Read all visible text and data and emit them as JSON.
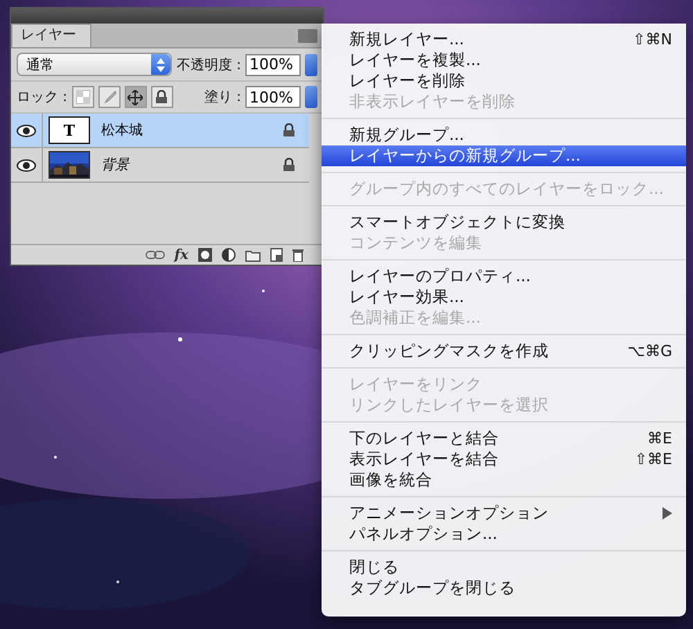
{
  "panel": {
    "tab": "レイヤー",
    "blend_mode": "通常",
    "opacity_label": "不透明度 :",
    "opacity": "100%",
    "lock_label": "ロック :",
    "fill_label": "塗り :",
    "fill": "100%",
    "locks": [
      {
        "kind": "pixels",
        "selected": false
      },
      {
        "kind": "paint",
        "selected": false
      },
      {
        "kind": "position",
        "selected": true
      },
      {
        "kind": "all",
        "selected": false
      }
    ],
    "layers": [
      {
        "kind": "text",
        "thumbnail_text": "T",
        "name": "松本城",
        "visible": true,
        "selected": true,
        "locked": true
      },
      {
        "name": "背景",
        "visible": true,
        "selected": false,
        "locked": true
      }
    ],
    "fx_label": "fx"
  },
  "menu": [
    {
      "items": [
        {
          "label": "新規レイヤー...",
          "shortcut": "⇧⌘N",
          "disabled": false,
          "selected": false
        },
        {
          "label": "レイヤーを複製...",
          "disabled": false,
          "selected": false
        },
        {
          "label": "レイヤーを削除",
          "disabled": false,
          "selected": false
        },
        {
          "label": "非表示レイヤーを削除",
          "disabled": true,
          "selected": false
        }
      ]
    },
    {
      "items": [
        {
          "label": "新規グループ...",
          "disabled": false,
          "selected": false
        },
        {
          "label": "レイヤーからの新規グループ...",
          "disabled": false,
          "selected": true
        }
      ]
    },
    {
      "items": [
        {
          "label": "グループ内のすべてのレイヤーをロック...",
          "disabled": true,
          "selected": false
        }
      ]
    },
    {
      "items": [
        {
          "label": "スマートオブジェクトに変換",
          "disabled": false,
          "selected": false
        },
        {
          "label": "コンテンツを編集",
          "disabled": true,
          "selected": false
        }
      ]
    },
    {
      "items": [
        {
          "label": "レイヤーのプロパティ...",
          "disabled": false,
          "selected": false
        },
        {
          "label": "レイヤー効果...",
          "disabled": false,
          "selected": false
        },
        {
          "label": "色調補正を編集...",
          "disabled": true,
          "selected": false
        }
      ]
    },
    {
      "items": [
        {
          "label": "クリッピングマスクを作成",
          "shortcut": "⌥⌘G",
          "disabled": false,
          "selected": false
        }
      ]
    },
    {
      "items": [
        {
          "label": "レイヤーをリンク",
          "disabled": true,
          "selected": false
        },
        {
          "label": "リンクしたレイヤーを選択",
          "disabled": true,
          "selected": false
        }
      ]
    },
    {
      "items": [
        {
          "label": "下のレイヤーと結合",
          "shortcut": "⌘E",
          "disabled": false,
          "selected": false
        },
        {
          "label": "表示レイヤーを結合",
          "shortcut": "⇧⌘E",
          "disabled": false,
          "selected": false
        },
        {
          "label": "画像を統合",
          "disabled": false,
          "selected": false
        }
      ]
    },
    {
      "items": [
        {
          "label": "アニメーションオプション",
          "submenu": true,
          "disabled": false,
          "selected": false
        },
        {
          "label": "パネルオプション...",
          "disabled": false,
          "selected": false
        }
      ]
    },
    {
      "items": [
        {
          "label": "閉じる",
          "disabled": false,
          "selected": false
        },
        {
          "label": "タブグループを閉じる",
          "disabled": false,
          "selected": false
        }
      ]
    }
  ]
}
